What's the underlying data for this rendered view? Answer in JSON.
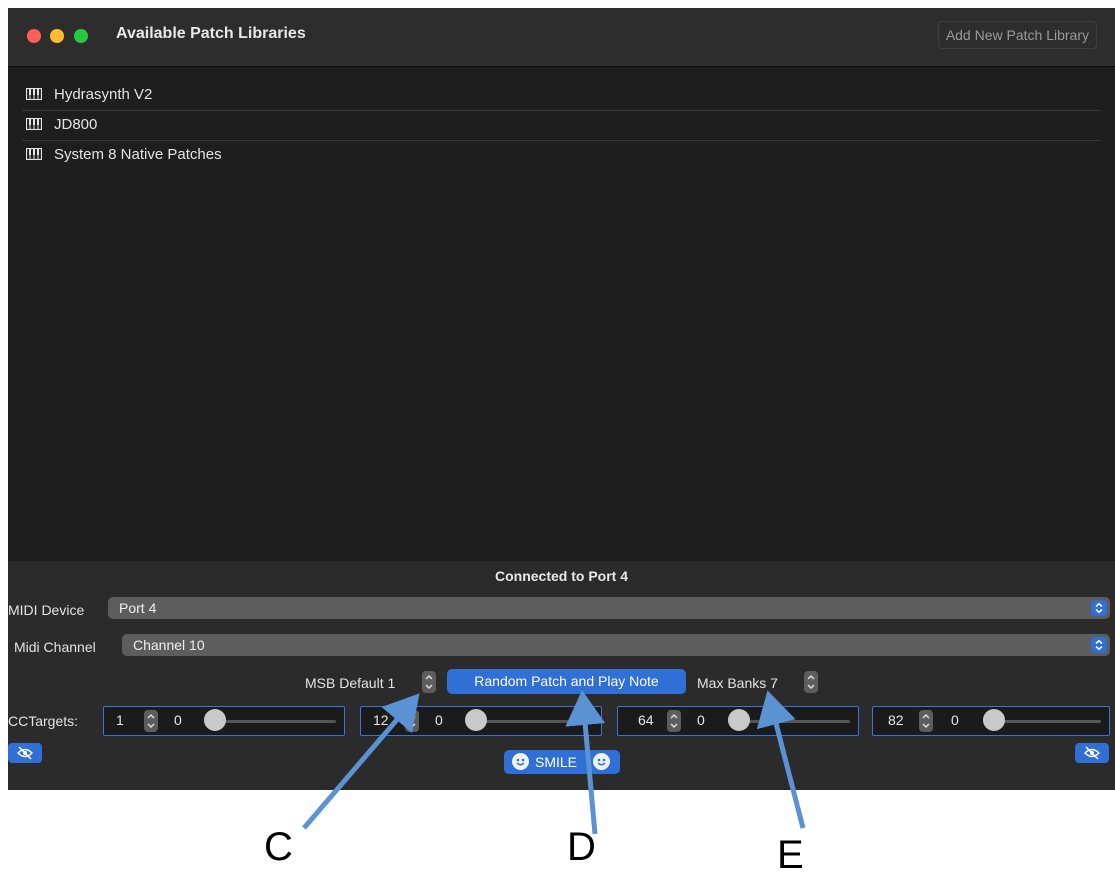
{
  "window": {
    "title": "Available Patch Libraries",
    "add_button_label": "Add New Patch Library"
  },
  "libraries": [
    {
      "label": "Hydrasynth V2",
      "icon": "piano-keys-icon"
    },
    {
      "label": "JD800",
      "icon": "piano-keys-icon"
    },
    {
      "label": "System 8 Native Patches",
      "icon": "piano-keys-icon"
    }
  ],
  "panel": {
    "status": "Connected to Port 4",
    "midi_device_label": "MIDI Device",
    "midi_device_value": "Port 4",
    "midi_channel_label": "Midi Channel",
    "midi_channel_value": "Channel 10",
    "msb_label": "MSB Default 1",
    "random_button_label": "Random Patch and Play Note",
    "max_banks_label": "Max Banks 7",
    "cc_targets_label": "CCTargets:",
    "cc_targets": [
      {
        "cc": "1",
        "value": "0",
        "slider": 0
      },
      {
        "cc": "12",
        "value": "0",
        "slider": 0
      },
      {
        "cc": "64",
        "value": "0",
        "slider": 0
      },
      {
        "cc": "82",
        "value": "0",
        "slider": 0
      }
    ],
    "smile_label": "SMILE"
  },
  "annotations": {
    "c": "C",
    "d": "D",
    "e": "E"
  },
  "colors": {
    "accent": "#2f6fd6",
    "arrow": "#5b92d3",
    "close": "#ff5f57",
    "minimize": "#febc2e",
    "zoom": "#28c840"
  }
}
